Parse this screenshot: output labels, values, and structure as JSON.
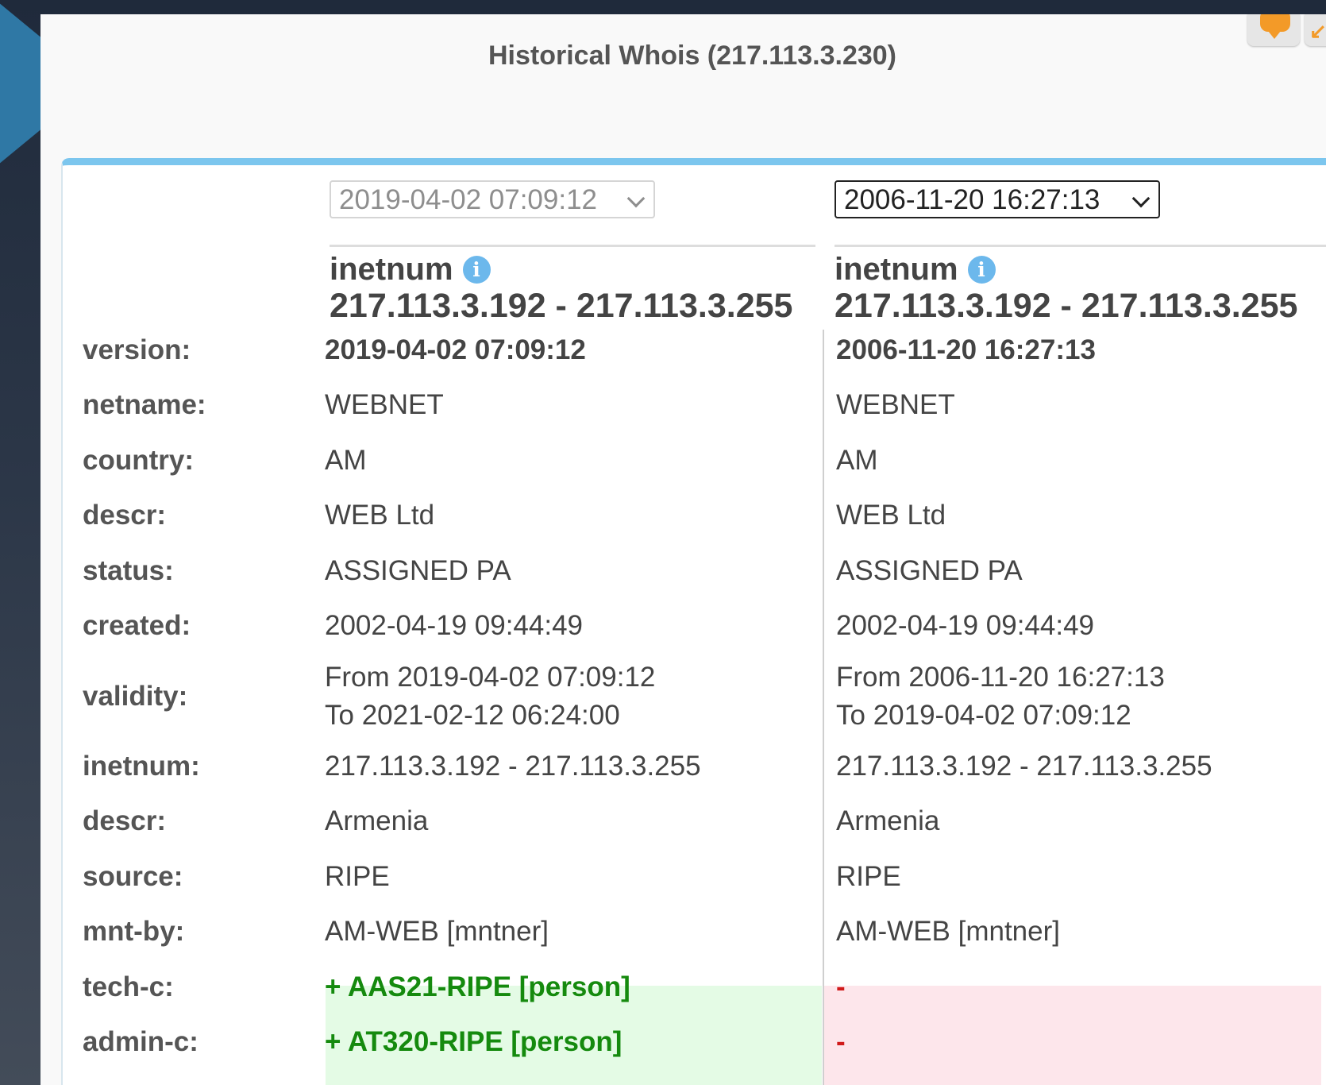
{
  "title": "Historical Whois (217.113.3.230)",
  "selects": {
    "left_value": "2019-04-02 07:09:12",
    "right_value": "2006-11-20 16:27:13"
  },
  "columns": {
    "left": {
      "type": "inetnum",
      "range": "217.113.3.192 - 217.113.3.255"
    },
    "right": {
      "type": "inetnum",
      "range": "217.113.3.192 - 217.113.3.255"
    }
  },
  "rows": [
    {
      "label": "version:",
      "left": "2019-04-02 07:09:12",
      "right": "2006-11-20 16:27:13"
    },
    {
      "label": "netname:",
      "left": "WEBNET",
      "right": "WEBNET"
    },
    {
      "label": "country:",
      "left": "AM",
      "right": "AM"
    },
    {
      "label": "descr:",
      "left": "WEB Ltd",
      "right": "WEB Ltd"
    },
    {
      "label": "status:",
      "left": "ASSIGNED PA",
      "right": "ASSIGNED PA"
    },
    {
      "label": "created:",
      "left": "2002-04-19 09:44:49",
      "right": "2002-04-19 09:44:49"
    },
    {
      "label": "validity:",
      "left_from": "From 2019-04-02 07:09:12",
      "left_to": "To 2021-02-12 06:24:00",
      "right_from": "From 2006-11-20 16:27:13",
      "right_to": "To 2019-04-02 07:09:12"
    },
    {
      "label": "inetnum:",
      "left": "217.113.3.192 - 217.113.3.255",
      "right": "217.113.3.192 - 217.113.3.255"
    },
    {
      "label": "descr:",
      "left": "Armenia",
      "right": "Armenia"
    },
    {
      "label": "source:",
      "left": "RIPE",
      "right": "RIPE"
    },
    {
      "label": "mnt-by:",
      "left": "AM-WEB [mntner]",
      "right": "AM-WEB [mntner]"
    },
    {
      "label": "tech-c:",
      "left": "+ AAS21-RIPE [person]",
      "right": "-"
    },
    {
      "label": "admin-c:",
      "left": "+ AT320-RIPE [person]",
      "right": "-"
    }
  ],
  "icons": {
    "info": "info-icon",
    "comment": "speech-bubble-icon",
    "collapse": "arrow-icon"
  },
  "colors": {
    "accent": "#7cc6ee",
    "added_bg": "#e4fbe5",
    "added_text": "#158a0e",
    "removed_bg": "#fde6eb",
    "removed_text": "#d01a1a"
  }
}
